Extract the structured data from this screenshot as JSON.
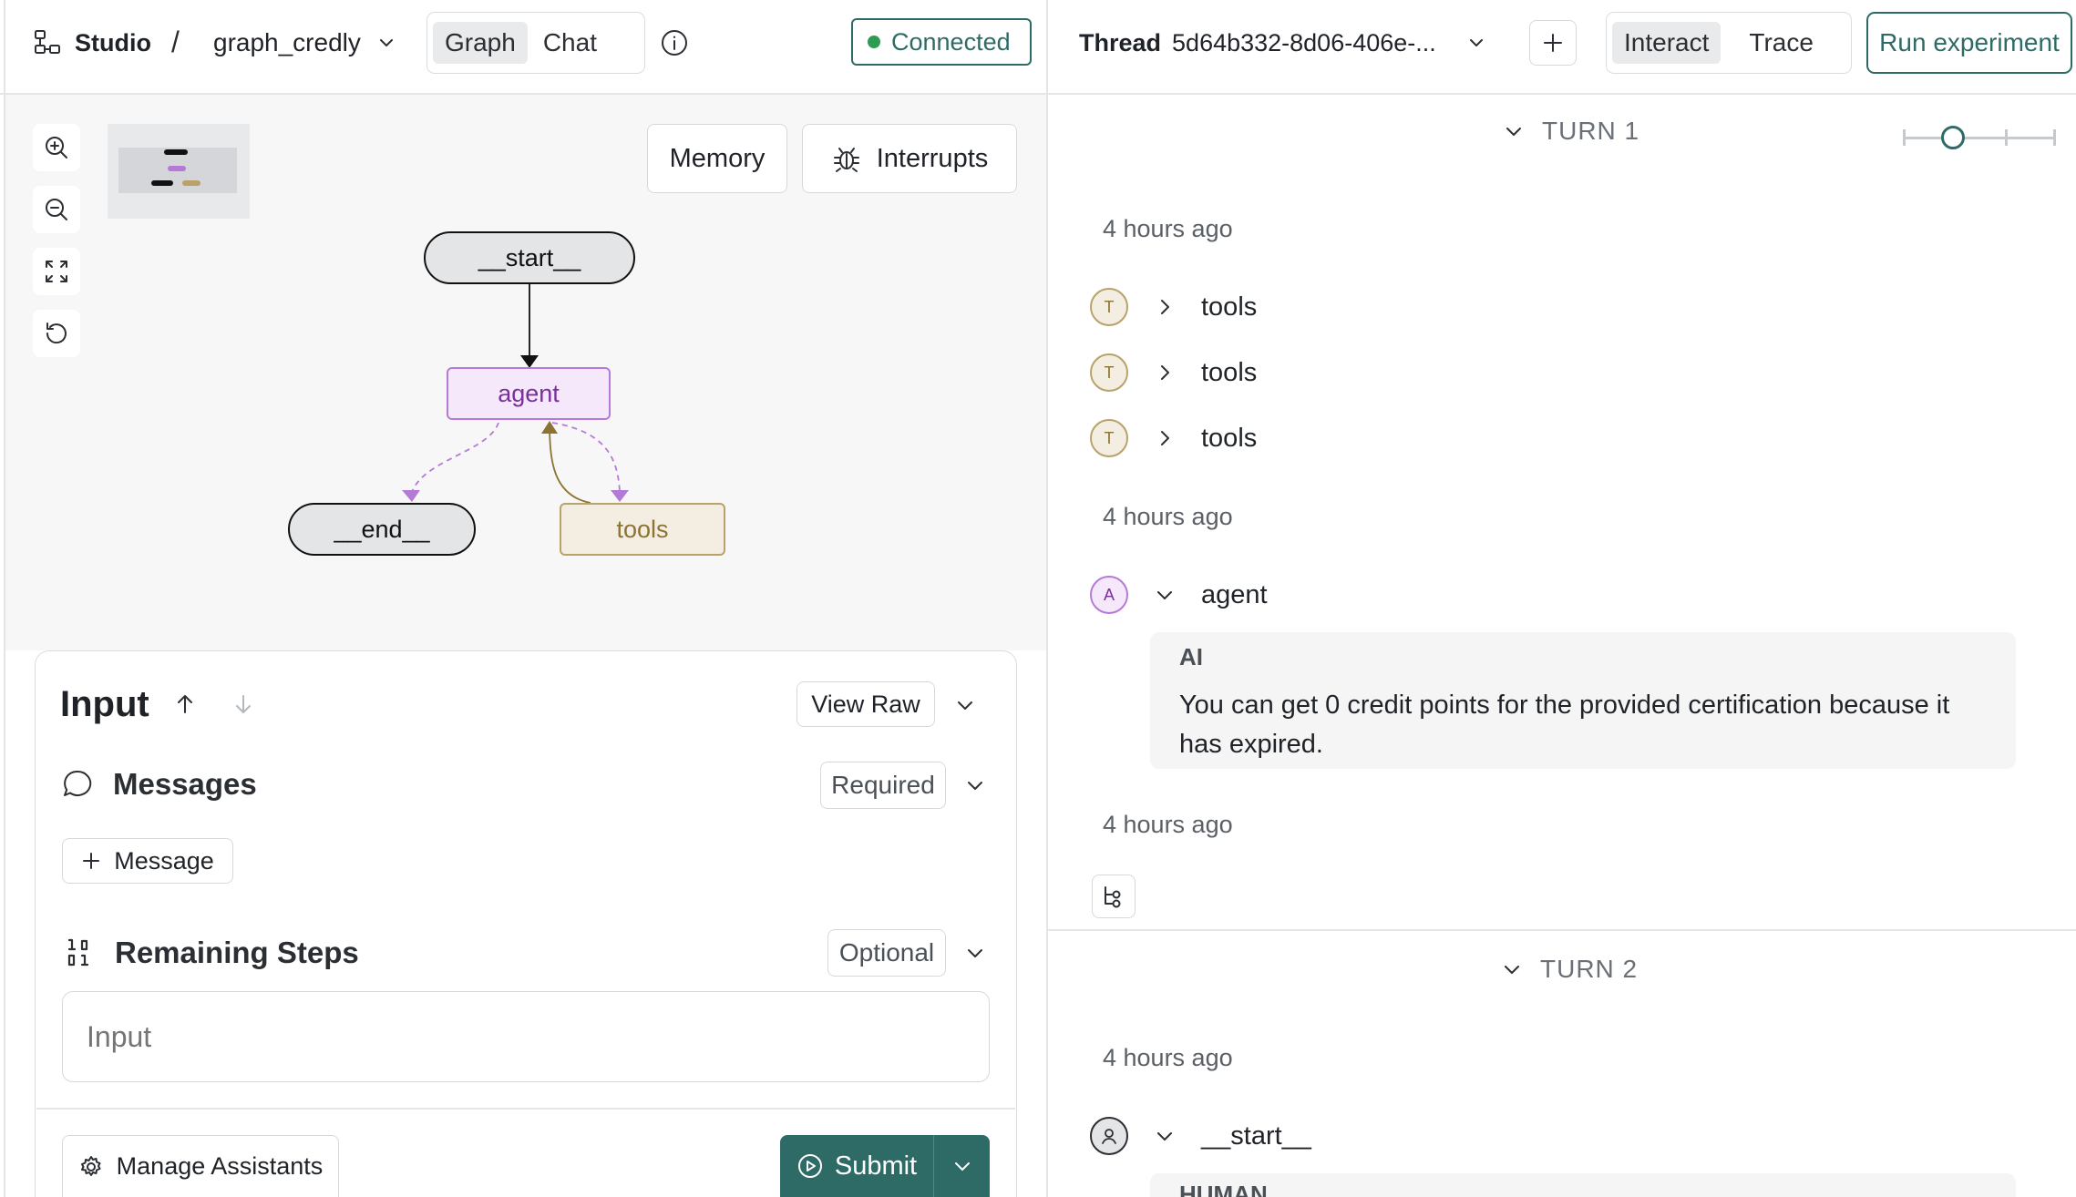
{
  "header": {
    "studio_label": "Studio",
    "separator": "/",
    "graph_name": "graph_credly",
    "view_tabs": [
      {
        "label": "Graph",
        "active": true
      },
      {
        "label": "Chat",
        "active": false
      }
    ],
    "connection_status": "Connected",
    "status_color": "#2e9b55"
  },
  "thread_bar": {
    "thread_label": "Thread",
    "thread_id": "5d64b332-8d06-406e-...",
    "mode_tabs": [
      {
        "label": "Interact",
        "active": true
      },
      {
        "label": "Trace",
        "active": false
      }
    ],
    "run_experiment_label": "Run experiment"
  },
  "graph": {
    "memory_label": "Memory",
    "interrupts_label": "Interrupts",
    "nodes": {
      "start": "__start__",
      "agent": "agent",
      "end": "__end__",
      "tools": "tools"
    },
    "colors": {
      "agent_fill": "#f5e8fb",
      "agent_border": "#b57ad6",
      "agent_text": "#7a2f9c",
      "tools_fill": "#f3eee1",
      "tools_border": "#b9a26a",
      "tools_text": "#8c7332",
      "terminal_fill": "#e4e5e7"
    }
  },
  "input_panel": {
    "title": "Input",
    "view_raw_label": "View Raw",
    "messages": {
      "label": "Messages",
      "badge": "Required",
      "add_label": "Message"
    },
    "remaining_steps": {
      "label": "Remaining Steps",
      "badge": "Optional",
      "placeholder": "Input"
    },
    "manage_assistants_label": "Manage Assistants",
    "submit_label": "Submit",
    "submit_color": "#2f6b66"
  },
  "thread": {
    "turn1": {
      "label": "TURN 1",
      "time1": "4 hours ago",
      "tool_steps": [
        {
          "avatar": "T",
          "name": "tools"
        },
        {
          "avatar": "T",
          "name": "tools"
        },
        {
          "avatar": "T",
          "name": "tools"
        }
      ],
      "time2": "4 hours ago",
      "agent_step": {
        "avatar": "A",
        "name": "agent",
        "message_role": "AI",
        "message_text": "You can get 0 credit points for the provided certification because it has expired."
      },
      "time3": "4 hours ago"
    },
    "turn2": {
      "label": "TURN 2",
      "time1": "4 hours ago",
      "start_step": {
        "name": "__start__",
        "message_role": "HUMAN"
      }
    },
    "slider_position": 0.33
  }
}
